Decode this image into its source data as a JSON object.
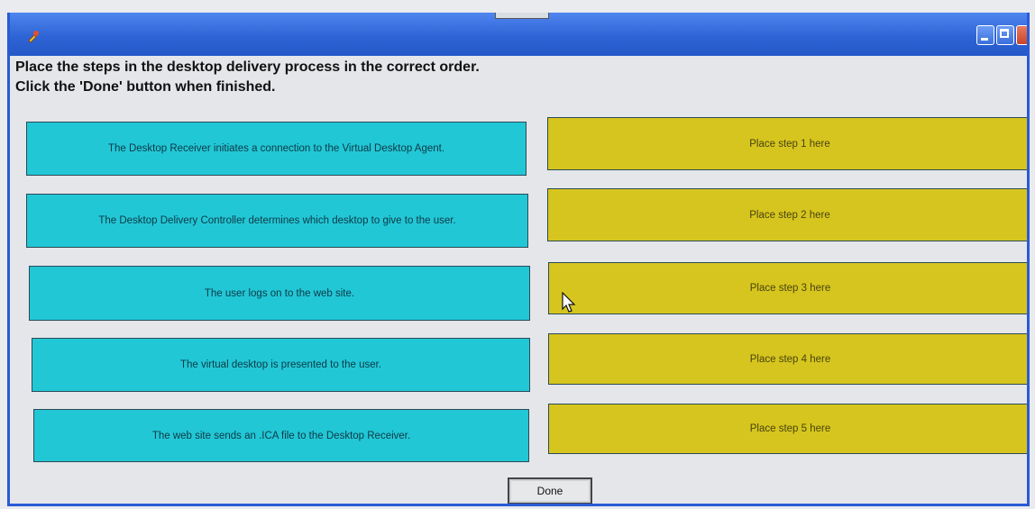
{
  "window": {
    "controls": [
      "minimize-icon",
      "maximize-icon",
      "close-icon"
    ],
    "title_icon": "app-icon"
  },
  "instructions": {
    "line1": "Place the steps in the desktop delivery process in the correct order.",
    "line2": "Click the 'Done' button when finished."
  },
  "steps": [
    "The Desktop Receiver initiates a connection to the Virtual Desktop Agent.",
    "The Desktop Delivery Controller determines which desktop to give to the user.",
    "The user logs on to the web site.",
    "The virtual desktop is presented to the user.",
    "The web site sends an .ICA file to the Desktop Receiver."
  ],
  "targets": [
    "Place step 1 here",
    "Place step 2 here",
    "Place step 3 here",
    "Place step 4 here",
    "Place step 5 here"
  ],
  "done_label": "Done",
  "colors": {
    "source": "#22c7d6",
    "target": "#d6c51e",
    "titlebar": "#2f64d6"
  }
}
